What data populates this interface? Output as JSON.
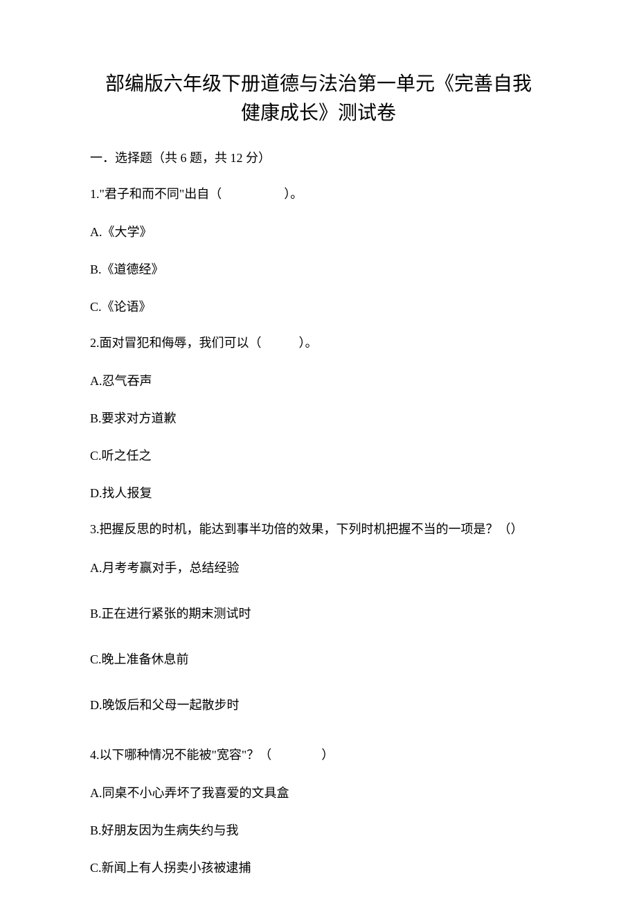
{
  "title_line1": "部编版六年级下册道德与法治第一单元《完善自我",
  "title_line2": "健康成长》测试卷",
  "section1_header": "一．选择题（共 6 题，共 12 分）",
  "q1": {
    "text": "1.\"君子和而不同\"出自（　　　　　）。",
    "optA": "A.《大学》",
    "optB": "B.《道德经》",
    "optC": "C.《论语》"
  },
  "q2": {
    "text": "2.面对冒犯和侮辱，我们可以（　　　）。",
    "optA": "A.忍气吞声",
    "optB": "B.要求对方道歉",
    "optC": "C.听之任之",
    "optD": "D.找人报复"
  },
  "q3": {
    "text": "3.把握反思的时机，能达到事半功倍的效果，下列时机把握不当的一项是？（）",
    "optA": "A.月考考赢对手，总结经验",
    "optB": "B.正在进行紧张的期末测试时",
    "optC": "C.晚上准备休息前",
    "optD": "D.晚饭后和父母一起散步时"
  },
  "q4": {
    "text": "4.以下哪种情况不能被\"宽容\"？（　　　　）",
    "optA": "A.同桌不小心弄坏了我喜爱的文具盒",
    "optB": "B.好朋友因为生病失约与我",
    "optC": "C.新闻上有人拐卖小孩被逮捕"
  }
}
